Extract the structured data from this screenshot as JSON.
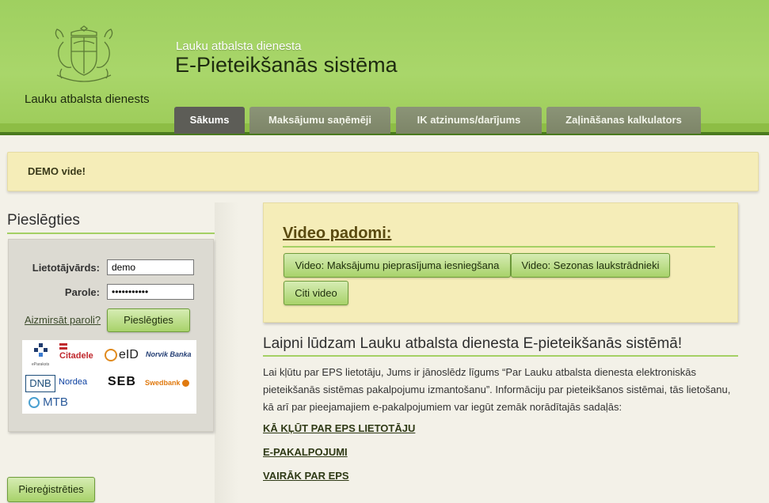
{
  "header": {
    "org_name": "Lauku atbalsta dienests",
    "subtitle": "Lauku atbalsta dienesta",
    "title": "E-Pieteikšanās sistēma"
  },
  "tabs": [
    {
      "label": "Sākums",
      "active": true
    },
    {
      "label": "Maksājumu saņēmēji",
      "active": false
    },
    {
      "label": "IK atzinums/darījums",
      "active": false
    },
    {
      "label": "Zaļināšanas kalkulators",
      "active": false
    }
  ],
  "demo_notice": "DEMO vide!",
  "login": {
    "title": "Pieslēgties",
    "username_label": "Lietotājvārds:",
    "username_value": "demo",
    "password_label": "Parole:",
    "password_value": "•••••••••••",
    "forgot_link": "Aizmirsāt paroli?",
    "submit_label": "Pieslēgties"
  },
  "banks": {
    "eparaksts": "eParaksts",
    "citadele": "Citadele",
    "eid": "eID",
    "norvik": "Norvik Banka",
    "dnb": "DNB",
    "nordea": "Nordea",
    "seb": "SEB",
    "swedbank": "Swedbank",
    "mtb": "MTB"
  },
  "register_button": "Piereģistrēties",
  "video": {
    "title": "Video padomi:",
    "buttons": [
      "Video: Maksājumu pieprasījuma iesniegšana",
      "Video: Sezonas laukstrādnieki",
      "Citi video"
    ]
  },
  "welcome": {
    "title": "Laipni lūdzam Lauku atbalsta dienesta E-pieteikšanās sistēmā!",
    "text": "Lai kļūtu par EPS lietotāju, Jums ir jānoslēdz līgums “Par Lauku atbalsta dienesta elektroniskās pieteikšanās sistēmas pakalpojumu izmantošanu”. Informāciju par pieteikšanos sistēmai, tās lietošanu, kā arī par pieejamajiem e-pakalpojumiem var iegūt zemāk norādītajās sadaļās:",
    "links": [
      "KĀ KĻŪT PAR EPS LIETOTĀJU",
      "E-PAKALPOJUMI",
      "VAIRĀK PAR EPS"
    ]
  },
  "colors": {
    "header_green": "#a9d66a",
    "accent_line": "#a4d064",
    "notice_bg": "#f5edb8",
    "tab_active": "#5d5d57",
    "tab_inactive": "#848c6f"
  }
}
